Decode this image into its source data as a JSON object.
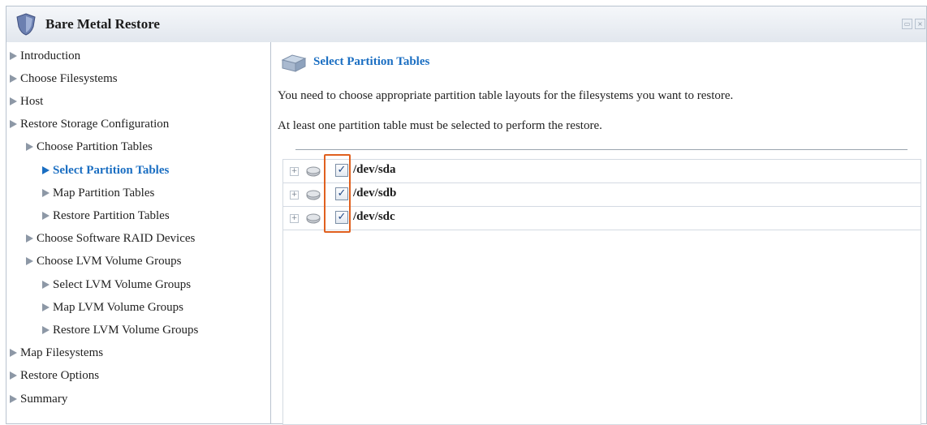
{
  "window": {
    "title": "Bare Metal Restore",
    "buttons": [
      "maximize-icon",
      "close-icon"
    ]
  },
  "sidebar": {
    "items": [
      {
        "label": "Introduction",
        "active": false
      },
      {
        "label": "Choose Filesystems",
        "active": false
      },
      {
        "label": "Host",
        "active": false
      },
      {
        "label": "Restore Storage Configuration",
        "active": false
      },
      {
        "label": "Choose Partition Tables",
        "active": false
      },
      {
        "label": "Select Partition Tables",
        "active": true
      },
      {
        "label": "Map Partition Tables",
        "active": false
      },
      {
        "label": "Restore Partition Tables",
        "active": false
      },
      {
        "label": "Choose Software RAID Devices",
        "active": false
      },
      {
        "label": "Choose LVM Volume Groups",
        "active": false
      },
      {
        "label": "Select LVM Volume Groups",
        "active": false
      },
      {
        "label": "Map LVM Volume Groups",
        "active": false
      },
      {
        "label": "Restore LVM Volume Groups",
        "active": false
      },
      {
        "label": "Map Filesystems",
        "active": false
      },
      {
        "label": "Restore Options",
        "active": false
      },
      {
        "label": "Summary",
        "active": false
      }
    ]
  },
  "content": {
    "title": "Select Partition Tables",
    "intro": "You need to choose appropriate partition table layouts for the filesystems you want to restore.",
    "note": "At least one partition table must be selected to perform the restore.",
    "disks": [
      {
        "name": "/dev/sda",
        "checked": true
      },
      {
        "name": "/dev/sdb",
        "checked": true
      },
      {
        "name": "/dev/sdc",
        "checked": true
      }
    ]
  },
  "colors": {
    "accent": "#1a6ec2",
    "highlight": "#e0601f",
    "border": "#b9c3cf"
  }
}
